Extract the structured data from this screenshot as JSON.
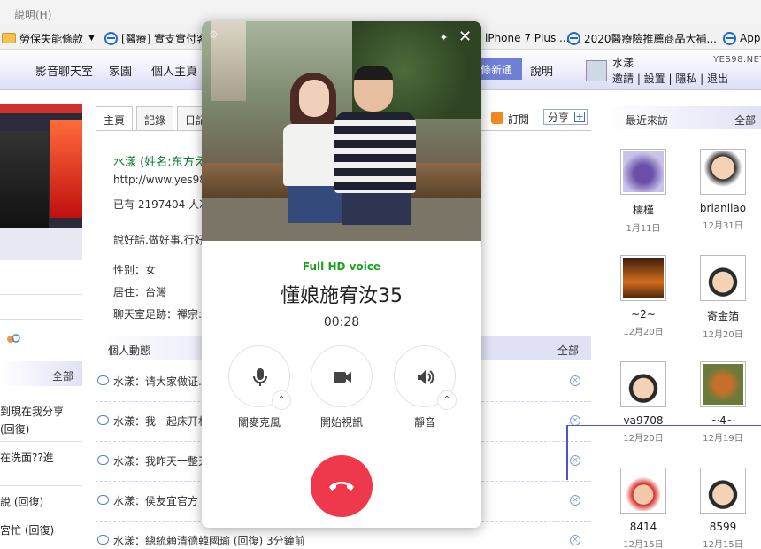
{
  "browser": {
    "menu_help": "說明(H)",
    "favorites": [
      {
        "label": "勞保失能條款",
        "has_caret": true,
        "icon": "folder-icon"
      },
      {
        "label": "[醫療] 實支實付客",
        "icon": "ie-icon"
      },
      {
        "label": "iPhone 7 Plus ...",
        "icon": "ie-icon"
      },
      {
        "label": "2020醫療險推薦商品大補...",
        "icon": "ie-icon"
      },
      {
        "label": "App",
        "icon": "ie-icon"
      }
    ]
  },
  "site_nav": {
    "items": [
      "影音聊天室",
      "家園",
      "個人主頁"
    ],
    "active_partial": "條新通",
    "help": "說明",
    "user_name": "水漾",
    "brand": "YES98.NET",
    "user_links": "邀請 | 設置 | 隱私 | 退出"
  },
  "left": {
    "section_all": "全部",
    "items": [
      "到現在我分享",
      "(回復)",
      "在洗面??進",
      "說 (回復)",
      "宮忙 (回復)"
    ]
  },
  "tabs": {
    "home": "主頁",
    "records": "記錄",
    "diary": "日記",
    "subscribe": "訂閱",
    "share": "分享",
    "share_plus": "+"
  },
  "profile": {
    "name": "水漾 (姓名:东方え",
    "url": "http://www.yes98.n",
    "visits": "已有 2197404 人次",
    "motto": "說好話.做好事.行好",
    "gender": "性别：女",
    "residence": "居住：台灣",
    "chatroom": "聊天室足跡：禪宗:"
  },
  "activity": {
    "title": "個人動態",
    "all": "全部",
    "rows": [
      "水漾：请大家做证.",
      "水漾：我一起床开机",
      "水漾：我昨天一整天",
      "水漾：侯友宜官方",
      "水漾：總統賴清德韓國瑜 (回復) 3分鐘前"
    ]
  },
  "recent_visitors": {
    "title": "最近來訪",
    "all": "全部",
    "list": [
      {
        "name": "檽槿",
        "date": "1月11日",
        "avatar": "bird-avatar"
      },
      {
        "name": "brianliao",
        "date": "12月31日",
        "avatar": "cartoon-man-avatar"
      },
      {
        "name": "~2~",
        "date": "12月20日",
        "avatar": "sunset-avatar"
      },
      {
        "name": "寄金箔",
        "date": "12月20日",
        "avatar": "cartoon-child-avatar"
      },
      {
        "name": "va9708",
        "date": "12月20日",
        "avatar": "cartoon-child-avatar"
      },
      {
        "name": "~4~",
        "date": "12月19日",
        "avatar": "fox-avatar"
      },
      {
        "name": "8414",
        "date": "12月15日",
        "avatar": "santa-avatar"
      },
      {
        "name": "8599",
        "date": "12月15日",
        "avatar": "cartoon-child-avatar"
      }
    ]
  },
  "call": {
    "quality": "Full HD voice",
    "callee": "懂娘施宥汝35",
    "duration": "00:28",
    "controls": [
      {
        "label": "關麥克風",
        "icon": "microphone-icon"
      },
      {
        "label": "開始視訊",
        "icon": "video-camera-icon"
      },
      {
        "label": "靜音",
        "icon": "speaker-icon"
      }
    ],
    "hangup_icon": "hang-up-icon",
    "colors": {
      "quality": "#1aa31a",
      "hangup": "#f0384c"
    }
  }
}
